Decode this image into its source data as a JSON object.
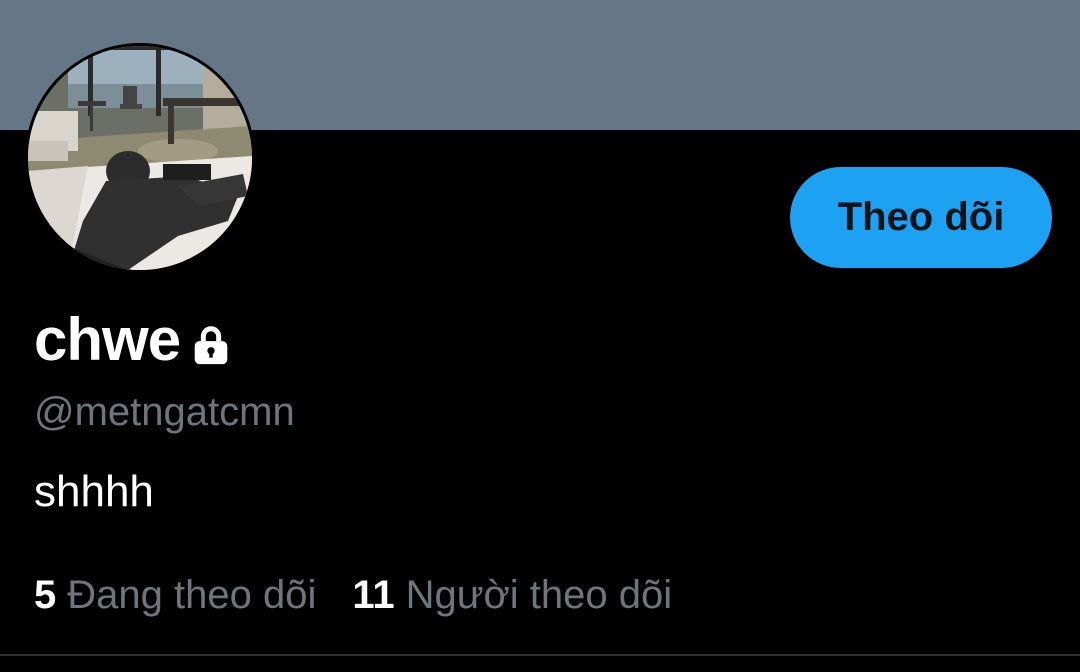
{
  "colors": {
    "banner": "#657786",
    "background": "#000000",
    "accent": "#1da1f2",
    "secondary_text": "#6e767d",
    "primary_text": "#ffffff"
  },
  "profile": {
    "display_name": "chwe",
    "protected_icon": "lock-icon",
    "handle": "@metngatcmn",
    "bio": "shhhh",
    "follow_button_label": "Theo dõi"
  },
  "stats": {
    "following_count": "5",
    "following_label": "Đang theo dõi",
    "followers_count": "11",
    "followers_label": "Người theo dõi"
  }
}
